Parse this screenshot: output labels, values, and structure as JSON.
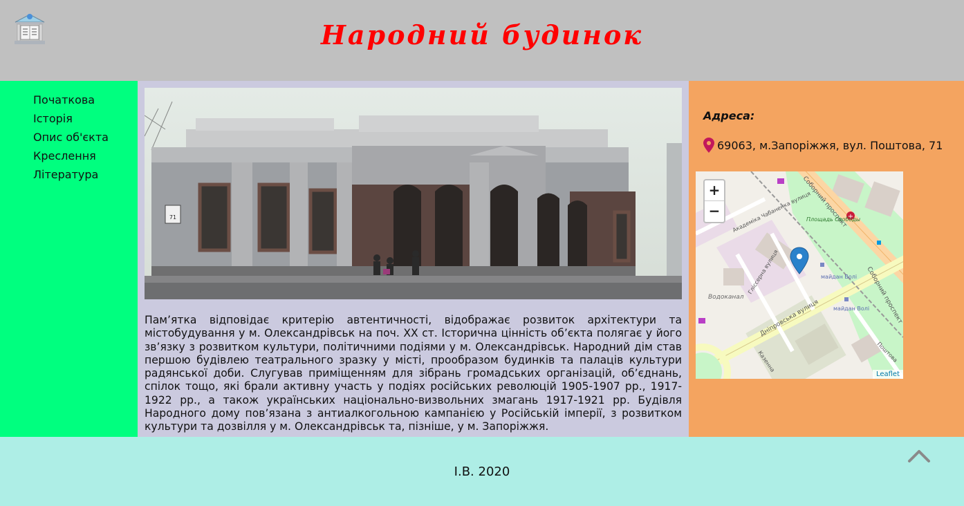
{
  "header": {
    "title": "Народний будинок"
  },
  "nav": {
    "items": [
      {
        "label": "Початкова"
      },
      {
        "label": "Історія"
      },
      {
        "label": "Опис об'єкта"
      },
      {
        "label": "Креслення"
      },
      {
        "label": "Література"
      }
    ]
  },
  "main": {
    "photo_sign": "71",
    "description": "Пам’ятка відповідає критерію автентичності, відображає розвиток архітектури та містобудування у м. Олександрівськ на поч. XX ст. Історична цінність об’єкта полягає у його зв’язку з розвитком культури, політичними подіями у м. Олександрівськ. Народний дім став першою будівлею театрального зразку у місті, прообразом будинків та палаців культури радянської доби. Слугував приміщенням для зібрань громадських організацій, об’єднань, спілок тощо, які брали активну участь у подіях російських революцій 1905-1907 рр., 1917-1922 рр., а також українських національно-визвольних змагань 1917-1921 рр. Будівля Народного дому пов’язана з антиалкогольною кампанією у Російській імперії, з розвитком культури та дозвілля у м. Олександрівськ та, пізніше, у м. Запоріжжя."
  },
  "aside": {
    "address_heading": "Адреса:",
    "address": "69063, м.Запоріжжя, вул. Поштова, 71",
    "map": {
      "zoom_in": "+",
      "zoom_out": "−",
      "attribution": "Leaflet",
      "labels": {
        "street1": "Академіка Чабаненка вулиця",
        "street2": "Соборний проспект",
        "street3": "Соборний проспект",
        "street4": "Гліссерна вулиця",
        "street5": "Дніпровська вулиця",
        "square": "Площадь Свободы",
        "vodokanal": "Водоканал",
        "stop1": "майдан Волі",
        "stop2": "майдан Волі",
        "kazenna": "Казенна",
        "poshtova": "Поштова"
      }
    }
  },
  "footer": {
    "copyright": "І.В. 2020"
  },
  "colors": {
    "header_bg": "#c0c0c0",
    "title": "#ff0000",
    "sidebar_bg": "#00ff7f",
    "main_bg": "#cbcadf",
    "aside_bg": "#f4a460",
    "footer_bg": "#aeeee6",
    "pin": "#c2185b"
  },
  "icons": {
    "logo": "library-building-icon",
    "pin": "map-pin-icon",
    "scroll_top": "chevron-up-icon"
  }
}
